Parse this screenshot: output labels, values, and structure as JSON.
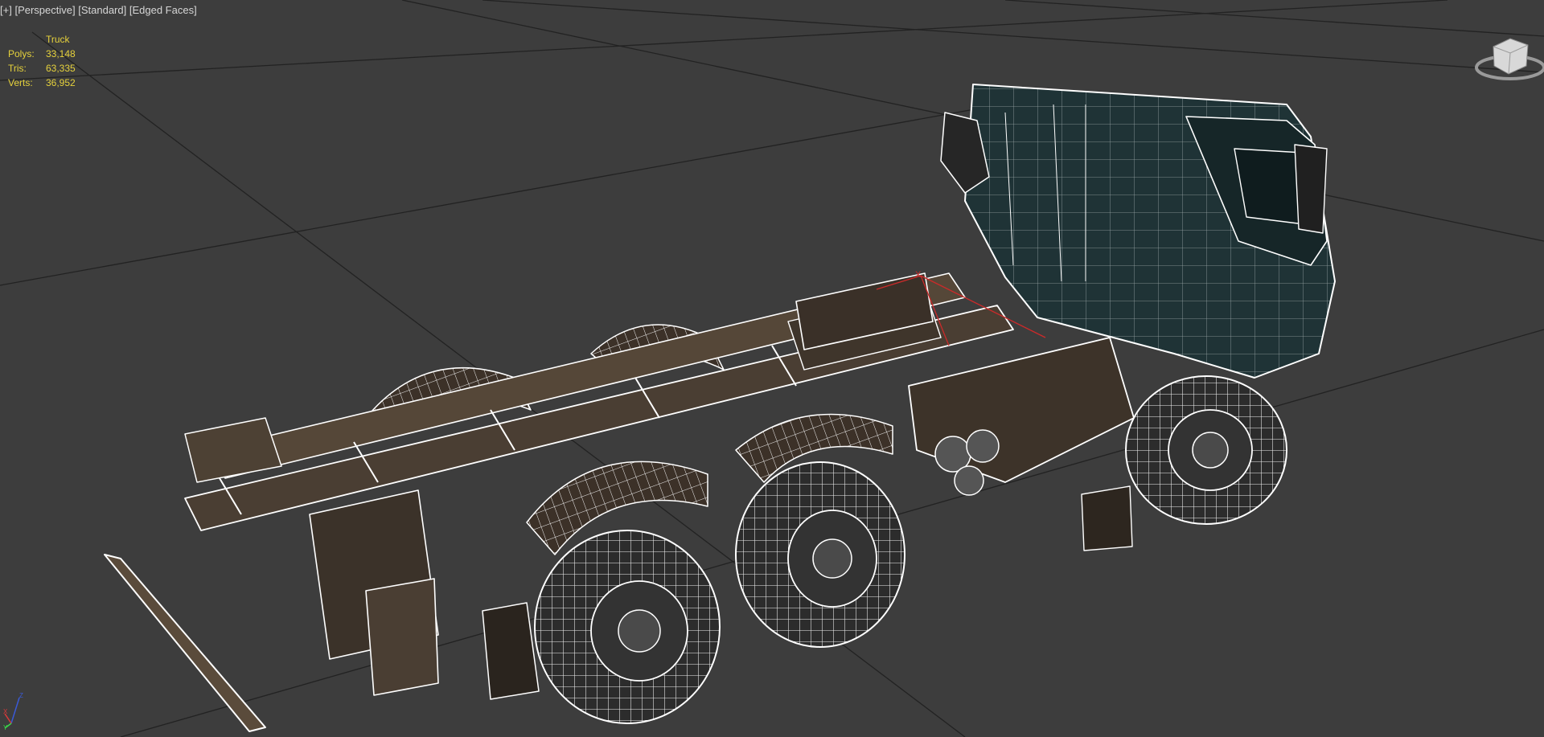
{
  "viewport": {
    "menu_plus": "[+]",
    "view_mode": "[Perspective]",
    "shading_mode": "[Standard]",
    "display_mode": "[Edged Faces]"
  },
  "stats": {
    "object_name": "Truck",
    "rows": [
      {
        "label": "Polys:",
        "value": "33,148"
      },
      {
        "label": "Tris:",
        "value": "63,335"
      },
      {
        "label": "Verts:",
        "value": "36,952"
      }
    ]
  },
  "axes": {
    "x": "X",
    "y": "Y",
    "z": "Z"
  },
  "colors": {
    "background": "#3d3d3d",
    "grid": "#1e1e1e",
    "stats_text": "#e6d23c",
    "label_text": "#d6d6d6",
    "wire": "#ffffff",
    "chassis": "#4a3e33",
    "cab": "#203538",
    "gizmo_red": "#cc2a2a"
  },
  "icons": {
    "viewcube": "viewcube-icon",
    "axis_tripod": "axis-tripod-icon"
  }
}
